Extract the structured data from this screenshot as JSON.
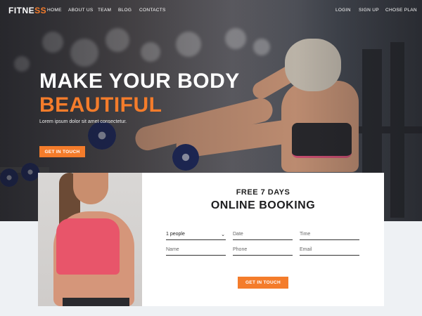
{
  "brand": {
    "prefix": "FITNE",
    "accent": "SS"
  },
  "nav_left": [
    "HOME",
    "ABOUT US",
    "TEAM",
    "BLOG",
    "CONTACTS"
  ],
  "nav_right": [
    "LOGIN",
    "SIGN UP",
    "CHOSE PLAN"
  ],
  "hero": {
    "title_line1": "MAKE YOUR BODY",
    "title_line2": "BEAUTIFUL",
    "subtitle": "Lorem ipsum dolor sit amet consectetur.",
    "cta": "GET IN TOUCH"
  },
  "booking": {
    "kicker": "FREE 7 DAYS",
    "title": "ONLINE BOOKING",
    "people_select": "1 people",
    "date_placeholder": "Date",
    "time_placeholder": "Time",
    "name_placeholder": "Name",
    "phone_placeholder": "Phone",
    "email_placeholder": "Email",
    "cta": "GET IN TOUCH"
  },
  "colors": {
    "accent": "#f47c2b",
    "dark": "#1d1d1f",
    "page_bg": "#eef1f4"
  }
}
